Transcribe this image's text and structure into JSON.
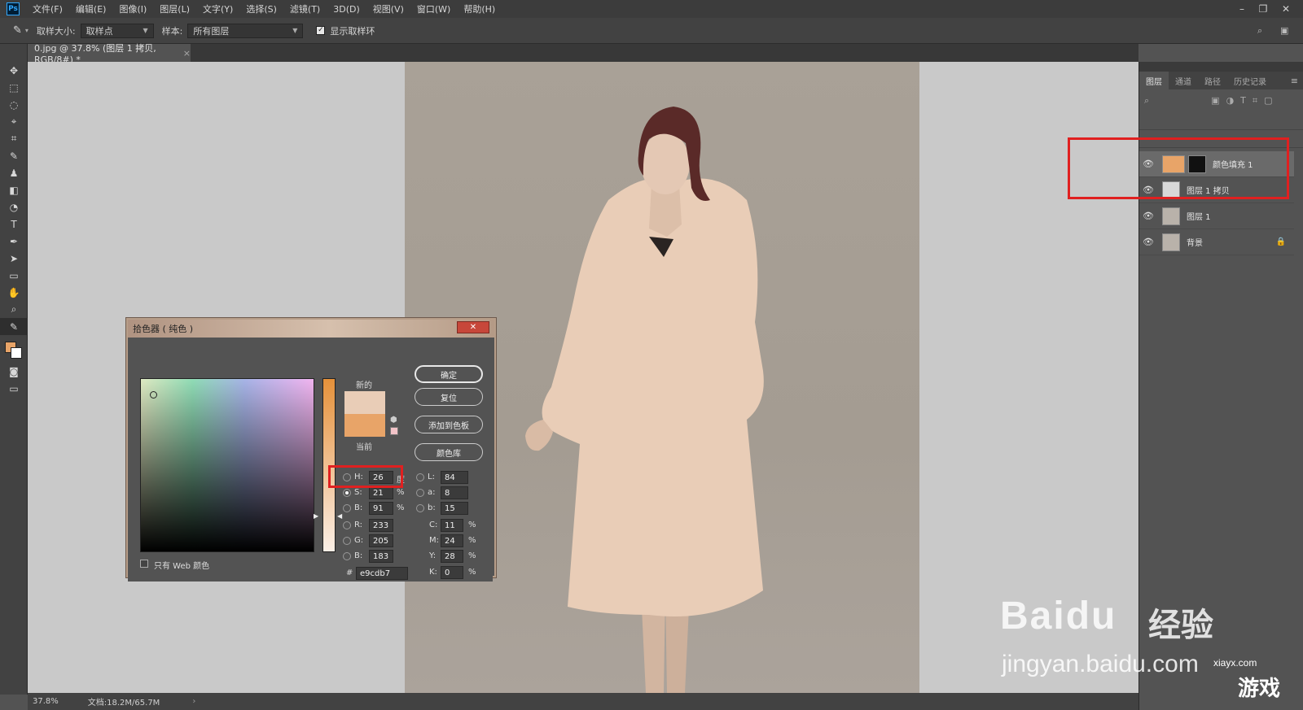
{
  "app": {
    "logo": "Ps"
  },
  "menu": [
    "文件(F)",
    "编辑(E)",
    "图像(I)",
    "图层(L)",
    "文字(Y)",
    "选择(S)",
    "滤镜(T)",
    "3D(D)",
    "视图(V)",
    "窗口(W)",
    "帮助(H)"
  ],
  "options": {
    "sample_size_label": "取样大小:",
    "sample_size_value": "取样点",
    "sample_label": "样本:",
    "sample_value": "所有图层",
    "show_ring_label": "显示取样环"
  },
  "document_tab": {
    "title": "0.jpg @ 37.8% (图层 1 拷贝, RGB/8#) *",
    "close": "×"
  },
  "status": {
    "zoom": "37.8%",
    "doc": "文档:18.2M/65.7M"
  },
  "panel": {
    "tabs": [
      "图层",
      "通道",
      "路径",
      "历史记录"
    ],
    "layers": [
      {
        "name": "颜色填充 1",
        "thumb_color": "#e8a468",
        "selected": true
      },
      {
        "name": "图层 1 拷贝",
        "thumb_color": "#d8d8d8",
        "selected": false
      },
      {
        "name": "图层 1",
        "thumb_color": "#b9b2aa",
        "selected": false
      },
      {
        "name": "背景",
        "thumb_color": "#b9b2aa",
        "selected": false,
        "locked": true
      }
    ]
  },
  "color_picker": {
    "title": "拾色器 ( 纯色 )",
    "new_label": "新的",
    "current_label": "当前",
    "new_color": "#e9cdb7",
    "current_color": "#e8a468",
    "buttons": {
      "ok": "确定",
      "reset": "复位",
      "add_swatch": "添加到色板",
      "libraries": "颜色库"
    },
    "web_only_label": "只有 Web 颜色",
    "hsb": {
      "h_label": "H:",
      "h": "26",
      "h_unit": "度",
      "s_label": "S:",
      "s": "21",
      "s_unit": "%",
      "b_label": "B:",
      "b": "91",
      "b_unit": "%"
    },
    "lab": {
      "l_label": "L:",
      "l": "84",
      "a_label": "a:",
      "a": "8",
      "b_label": "b:",
      "b": "15"
    },
    "rgb": {
      "r_label": "R:",
      "r": "233",
      "g_label": "G:",
      "g": "205",
      "b_label": "B:",
      "b": "183"
    },
    "cmyk": {
      "c_label": "C:",
      "c": "11",
      "m_label": "M:",
      "m": "24",
      "y_label": "Y:",
      "y": "28",
      "k_label": "K:",
      "k": "0",
      "unit": "%"
    },
    "hex_label": "#",
    "hex": "e9cdb7"
  },
  "watermark": {
    "brand": "Baidu",
    "brand_cn": "经验",
    "url": "jingyan.baidu.com",
    "site": "xiayx.com",
    "game": "游戏"
  },
  "colors": {
    "fur_coat": "#e9cdb7",
    "highlight": "#e02020"
  }
}
